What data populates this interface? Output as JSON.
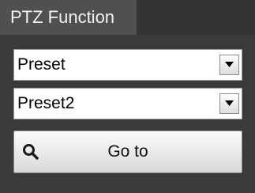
{
  "panel": {
    "title": "PTZ Function"
  },
  "controls": {
    "function_select": {
      "selected": "Preset"
    },
    "preset_select": {
      "selected": "Preset2"
    },
    "goto_button": {
      "label": "Go to",
      "icon": "search-icon"
    }
  },
  "colors": {
    "panel_background": "#3a3a3a",
    "header_tab": "#505050",
    "header_strip": "#333333",
    "field_background": "#ffffff"
  }
}
